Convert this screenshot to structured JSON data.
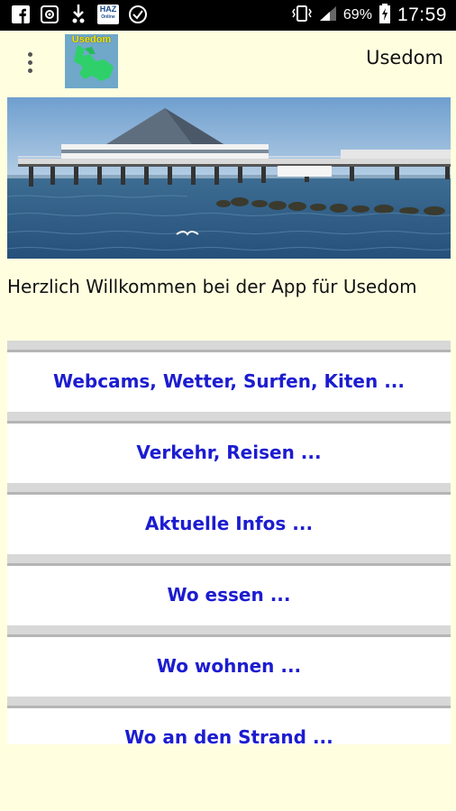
{
  "status_bar": {
    "haz_label": "HAZ",
    "haz_sub": "Online",
    "battery": "69%",
    "time": "17:59"
  },
  "toolbar": {
    "logo_text": "Usedom",
    "title": "Usedom"
  },
  "welcome_text": "Herzlich Willkommen bei der App für Usedom",
  "menu": [
    {
      "label": "Webcams, Wetter, Surfen, Kiten ..."
    },
    {
      "label": "Verkehr, Reisen ..."
    },
    {
      "label": "Aktuelle Infos ..."
    },
    {
      "label": "Wo essen ..."
    },
    {
      "label": "Wo wohnen ..."
    },
    {
      "label": "Wo an den Strand ..."
    }
  ],
  "colors": {
    "background": "#ffffe0",
    "link_text": "#1c1cd0",
    "status_bar": "#000000"
  }
}
